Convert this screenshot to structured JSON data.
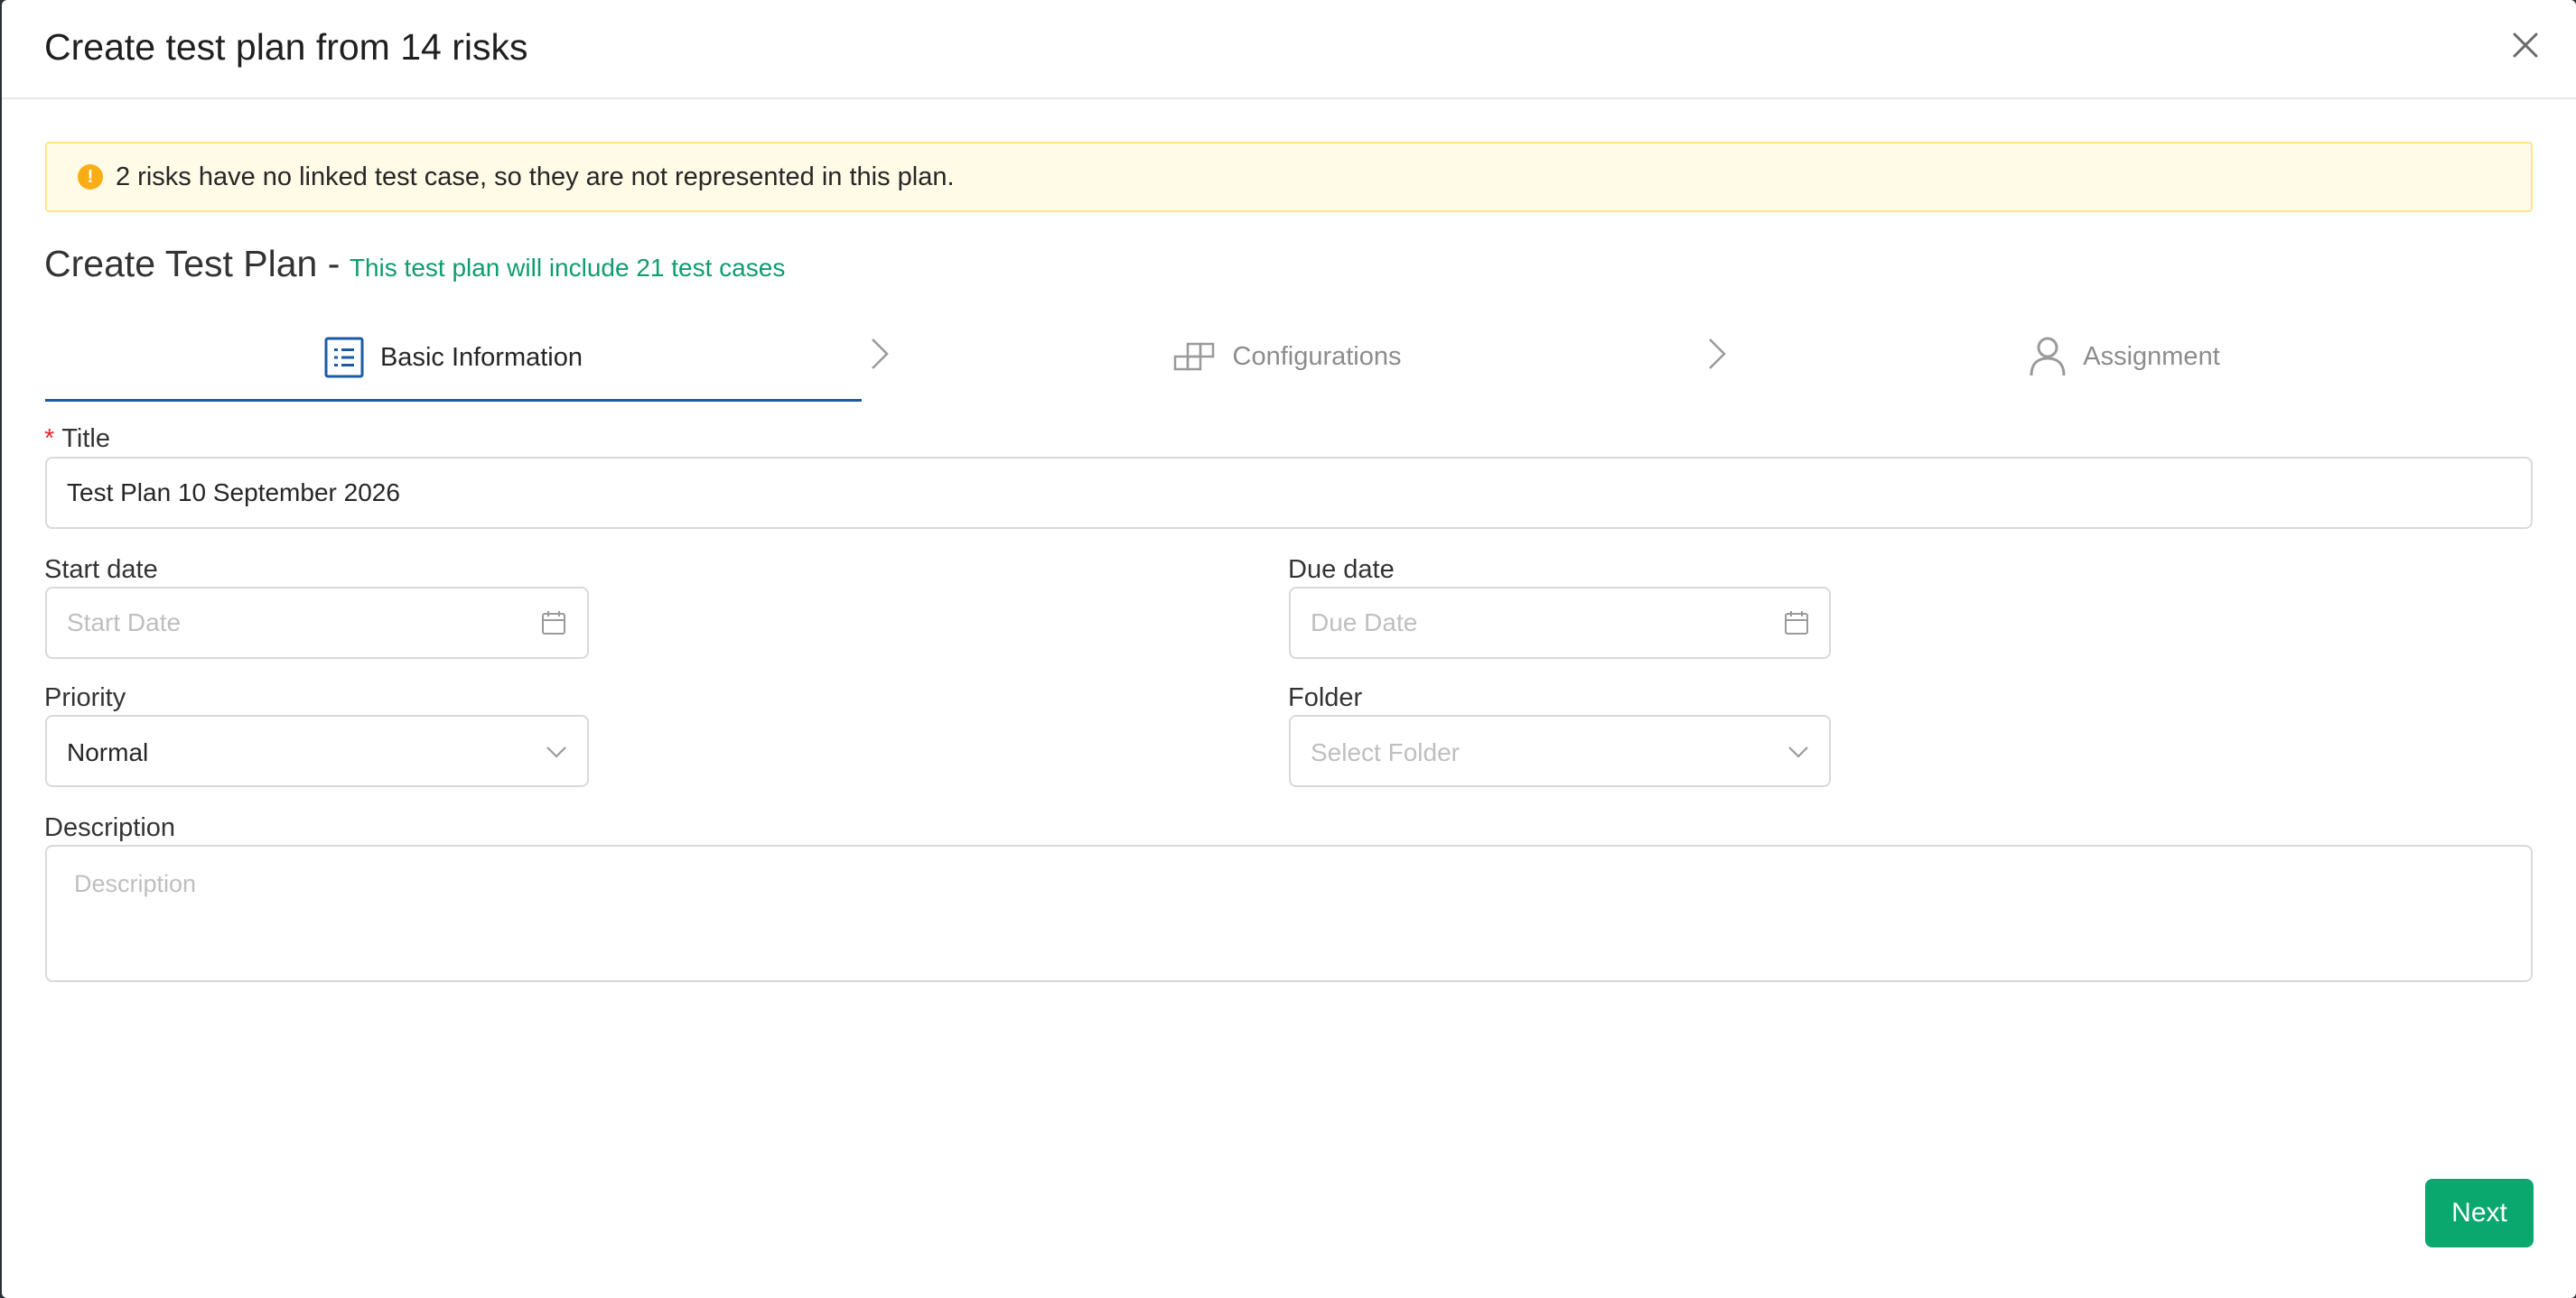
{
  "modal": {
    "title": "Create test plan from 14 risks"
  },
  "alert": {
    "icon": "exclamation",
    "text": "2 risks have no linked test case, so they are not represented in this plan."
  },
  "heading": {
    "main": "Create Test Plan -",
    "sub": "This test plan will include 21 test cases"
  },
  "steps": [
    {
      "label": "Basic Information",
      "icon": "list-icon",
      "active": true
    },
    {
      "label": "Configurations",
      "icon": "blocks-icon",
      "active": false
    },
    {
      "label": "Assignment",
      "icon": "user-icon",
      "active": false
    }
  ],
  "form": {
    "title": {
      "label": "Title",
      "required_mark": "*",
      "value": "Test Plan 10 September 2026"
    },
    "start_date": {
      "label": "Start date",
      "placeholder": "Start Date",
      "value": ""
    },
    "due_date": {
      "label": "Due date",
      "placeholder": "Due Date",
      "value": ""
    },
    "priority": {
      "label": "Priority",
      "value": "Normal"
    },
    "folder": {
      "label": "Folder",
      "placeholder": "Select Folder"
    },
    "description": {
      "label": "Description",
      "placeholder": "Description",
      "value": ""
    }
  },
  "footer": {
    "next_label": "Next"
  },
  "colors": {
    "accent": "#1d5aa6",
    "primary_button": "#0aa86f",
    "success_text": "#0f9d6c",
    "warning_bg": "#fffbe6",
    "warning_border": "#ffe58f",
    "warning_icon": "#faad14",
    "required": "#e0282e"
  }
}
